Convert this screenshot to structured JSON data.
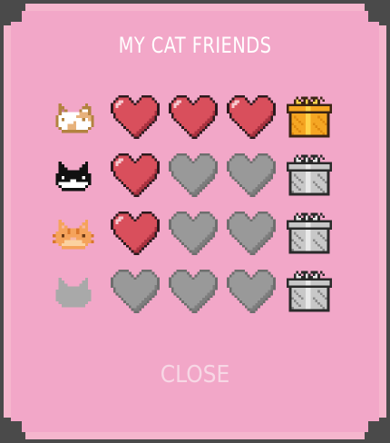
{
  "title": "MY CAT FRIENDS",
  "close_label": "CLOSE",
  "colors": {
    "heart_full": "#d94f5c",
    "heart_empty": "#999999",
    "gift_gold": "#f5a623",
    "gift_gray": "#c8c8c8"
  },
  "friends": [
    {
      "cat": "calico-cat-icon",
      "hearts_filled": 3,
      "hearts_total": 3,
      "gift": "gold"
    },
    {
      "cat": "tuxedo-cat-icon",
      "hearts_filled": 1,
      "hearts_total": 3,
      "gift": "gray"
    },
    {
      "cat": "orange-tabby-cat-icon",
      "hearts_filled": 1,
      "hearts_total": 3,
      "gift": "gray"
    },
    {
      "cat": "locked-gray-cat-icon",
      "hearts_filled": 0,
      "hearts_total": 3,
      "gift": "gray"
    }
  ]
}
